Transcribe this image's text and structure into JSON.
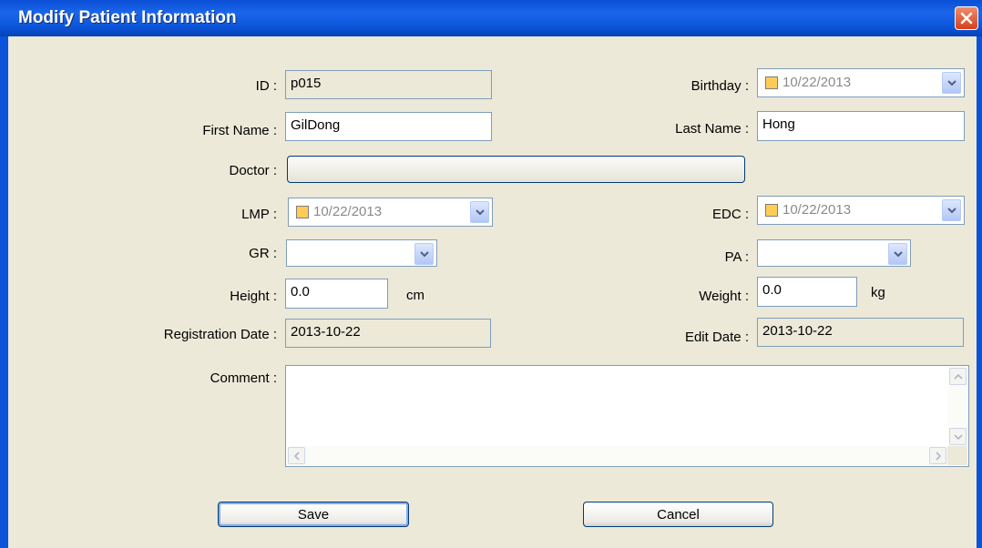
{
  "window": {
    "title": "Modify Patient Information",
    "close_icon": "close-x-icon",
    "accent_color": "#0b54d9"
  },
  "labels": {
    "id": "ID :",
    "birthday": "Birthday :",
    "first_name": "First Name :",
    "last_name": "Last Name :",
    "doctor": "Doctor :",
    "lmp": "LMP :",
    "edc": "EDC :",
    "gr": "GR :",
    "pa": "PA :",
    "height": "Height :",
    "weight": "Weight :",
    "registration_date": "Registration Date :",
    "edit_date": "Edit Date :",
    "comment": "Comment :"
  },
  "values": {
    "id": "p015",
    "birthday": "10/22/2013",
    "first_name": "GilDong",
    "last_name": "Hong",
    "doctor": "",
    "lmp": "10/22/2013",
    "edc": "10/22/2013",
    "gr": "",
    "pa": "",
    "height": "0.0",
    "weight": "0.0",
    "registration_date": "2013-10-22",
    "edit_date": "2013-10-22",
    "comment": ""
  },
  "units": {
    "height": "cm",
    "weight": "kg"
  },
  "buttons": {
    "save": "Save",
    "cancel": "Cancel"
  }
}
